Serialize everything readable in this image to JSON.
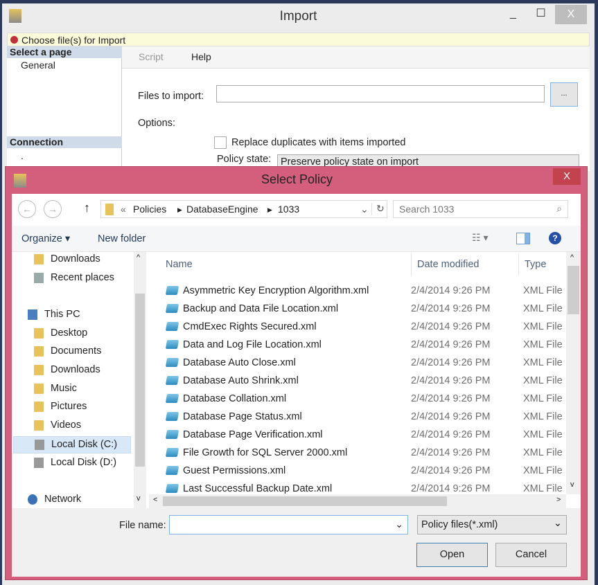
{
  "import_window": {
    "title": "Import",
    "close": "X",
    "error_message": "Choose file(s) for Import",
    "select_page_header": "Select a page",
    "pages": [
      "General"
    ],
    "connection_header": "Connection",
    "connection_value": ".",
    "toolbar": {
      "script": "Script",
      "help": "Help"
    },
    "files_label": "Files to import:",
    "files_value": "",
    "browse": "...",
    "options_label": "Options:",
    "replace_label": "Replace duplicates with items imported",
    "policy_state_label": "Policy state:",
    "policy_state_value": "Preserve policy state on import"
  },
  "dialog": {
    "title": "Select Policy",
    "close": "X",
    "breadcrumb": [
      "«",
      "Policies",
      "DatabaseEngine",
      "1033"
    ],
    "search_placeholder": "Search 1033",
    "organize": "Organize",
    "new_folder": "New folder",
    "nav": [
      {
        "label": "Downloads"
      },
      {
        "label": "Recent places"
      },
      {
        "label": "This PC"
      },
      {
        "label": "Desktop"
      },
      {
        "label": "Documents"
      },
      {
        "label": "Downloads"
      },
      {
        "label": "Music"
      },
      {
        "label": "Pictures"
      },
      {
        "label": "Videos"
      },
      {
        "label": "Local Disk (C:)"
      },
      {
        "label": "Local Disk (D:)"
      },
      {
        "label": "Network"
      }
    ],
    "columns": {
      "name": "Name",
      "date": "Date modified",
      "type": "Type"
    },
    "files": [
      {
        "name": "Asymmetric Key Encryption Algorithm.xml",
        "date": "2/4/2014 9:26 PM",
        "type": "XML File"
      },
      {
        "name": "Backup and Data File Location.xml",
        "date": "2/4/2014 9:26 PM",
        "type": "XML File"
      },
      {
        "name": "CmdExec Rights Secured.xml",
        "date": "2/4/2014 9:26 PM",
        "type": "XML File"
      },
      {
        "name": "Data and Log File Location.xml",
        "date": "2/4/2014 9:26 PM",
        "type": "XML File"
      },
      {
        "name": "Database Auto Close.xml",
        "date": "2/4/2014 9:26 PM",
        "type": "XML File"
      },
      {
        "name": "Database Auto Shrink.xml",
        "date": "2/4/2014 9:26 PM",
        "type": "XML File"
      },
      {
        "name": "Database Collation.xml",
        "date": "2/4/2014 9:26 PM",
        "type": "XML File"
      },
      {
        "name": "Database Page Status.xml",
        "date": "2/4/2014 9:26 PM",
        "type": "XML File"
      },
      {
        "name": "Database Page Verification.xml",
        "date": "2/4/2014 9:26 PM",
        "type": "XML File"
      },
      {
        "name": "File Growth for SQL Server 2000.xml",
        "date": "2/4/2014 9:26 PM",
        "type": "XML File"
      },
      {
        "name": "Guest Permissions.xml",
        "date": "2/4/2014 9:26 PM",
        "type": "XML File"
      },
      {
        "name": "Last Successful Backup Date.xml",
        "date": "2/4/2014 9:26 PM",
        "type": "XML File"
      }
    ],
    "file_name_label": "File name:",
    "file_name_value": "",
    "file_type": "Policy files(*.xml)",
    "open": "Open",
    "cancel": "Cancel"
  }
}
